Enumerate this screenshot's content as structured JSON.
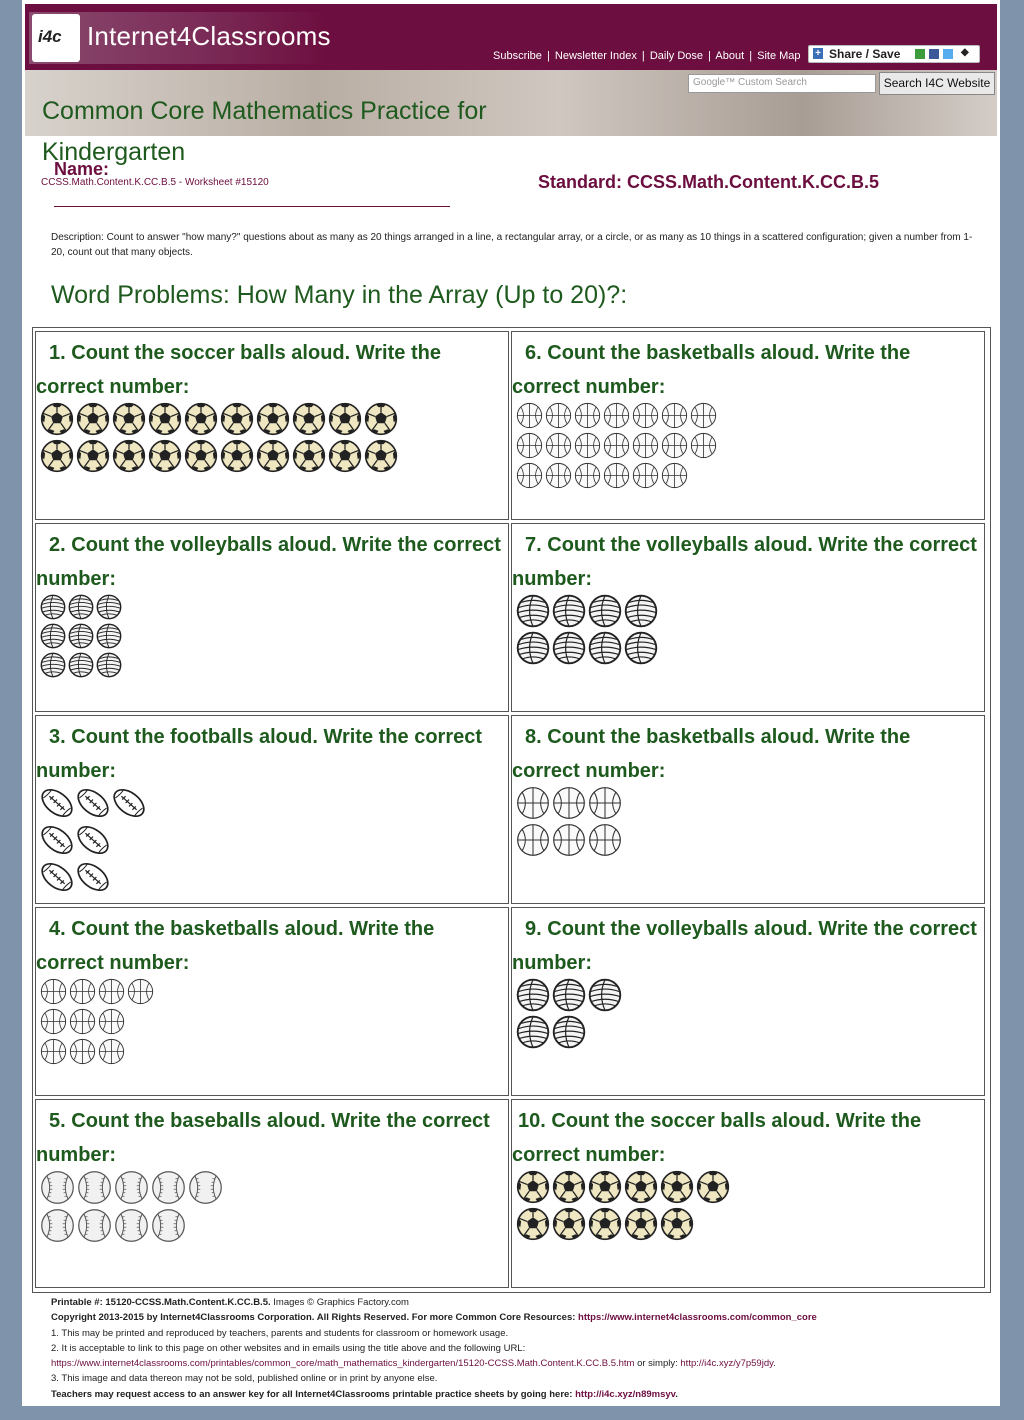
{
  "header": {
    "logo_mark": "i4c",
    "logo_text": "Internet4Classrooms",
    "nav": [
      "Subscribe",
      "Newsletter Index",
      "Daily Dose",
      "About",
      "Site Map"
    ],
    "nav_sep": "|",
    "share_label": "Share / Save",
    "search_placeholder": "Google™ Custom Search",
    "search_button": "Search I4C Website"
  },
  "title": "Common Core Mathematics Practice for Kindergarten",
  "name_label": "Name:",
  "worksheet_code": "CCSS.Math.Content.K.CC.B.5 - Worksheet #15120",
  "standard": "Standard: CCSS.Math.Content.K.CC.B.5",
  "description": "Description: Count to answer \"how many?\" questions about as many as 20 things arranged in a line, a rectangular array, or a circle, or as many as 10 things in a scattered configuration; given a number from 1-20, count out that many objects.",
  "section_title": "Word Problems: How Many in the Array (Up to 20)?:",
  "questions": [
    {
      "number": "1.",
      "text": "Count the soccer balls aloud. Write the correct number:",
      "ball": "soccer",
      "rows": [
        10,
        10
      ]
    },
    {
      "number": "2.",
      "text": "Count the volleyballs aloud. Write the correct number:",
      "ball": "volleyball-small",
      "rows": [
        3,
        3,
        3
      ]
    },
    {
      "number": "3.",
      "text": "Count the footballs aloud. Write the correct number:",
      "ball": "football",
      "rows": [
        3,
        2,
        2
      ]
    },
    {
      "number": "4.",
      "text": "Count the basketballs aloud. Write the correct number:",
      "ball": "basketball-small",
      "rows": [
        4,
        3,
        3
      ]
    },
    {
      "number": "5.",
      "text": "Count the baseballs aloud. Write the correct number:",
      "ball": "baseball",
      "rows": [
        5,
        4
      ]
    },
    {
      "number": "6.",
      "text": "Count the basketballs aloud. Write the correct number:",
      "ball": "basketball-small",
      "rows": [
        7,
        7,
        6
      ]
    },
    {
      "number": "7.",
      "text": "Count the volleyballs aloud. Write the correct number:",
      "ball": "volleyball",
      "rows": [
        4,
        4
      ]
    },
    {
      "number": "8.",
      "text": "Count the basketballs aloud. Write the correct number:",
      "ball": "basketball",
      "rows": [
        3,
        3
      ]
    },
    {
      "number": "9.",
      "text": "Count the volleyballs aloud. Write the correct number:",
      "ball": "volleyball",
      "rows": [
        3,
        2
      ]
    },
    {
      "number": "10.",
      "text": "Count the soccer balls aloud. Write the correct number:",
      "ball": "soccer",
      "rows": [
        6,
        5
      ]
    }
  ],
  "footer": {
    "printable_label": "Printable #:",
    "printable_value": "15120-CCSS.Math.Content.K.CC.B.5.",
    "images_credit": "Images © Graphics Factory.com",
    "copyright": "Copyright 2013-2015 by Internet4Classrooms Corporation. All Rights Reserved. For more Common Core Resources:",
    "common_core_url": "https://www.internet4classrooms.com/common_core",
    "note1": "1. This may be printed and reproduced by teachers, parents and students for classroom or homework usage.",
    "note2": "2. It is acceptable to link to this page on other websites and in emails using the title above and the following URL:",
    "page_url": "https://www.internet4classrooms.com/printables/common_core/math_mathematics_kindergarten/15120-CCSS.Math.Content.K.CC.B.5.htm",
    "or_simply": "or simply:",
    "short_url": "http://i4c.xyz/y7p59jdy",
    "note3": "3. This image and data thereon may not be sold, published online or in print by anyone else.",
    "answer_key_text": "Teachers may request access to an answer key for all Internet4Classrooms printable practice sheets by going here:",
    "answer_key_url": "http://i4c.xyz/n89msyv"
  }
}
